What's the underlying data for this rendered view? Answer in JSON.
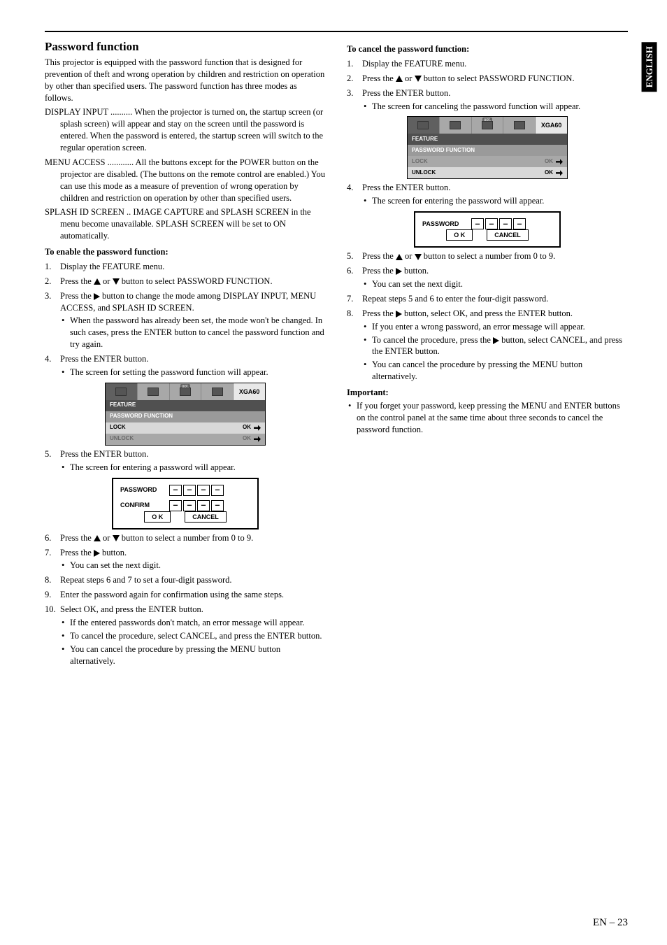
{
  "vert_label": "ENGLISH",
  "page_number": "EN – 23",
  "left": {
    "heading": "Password function",
    "intro": "This projector is equipped with the password function that is designed for prevention of theft and wrong operation by children and restriction on operation by other than specified users. The password function has three modes as follows.",
    "modes": [
      {
        "term": "DISPLAY INPUT",
        "dots": " .......... ",
        "def": "When the projector is turned on, the startup screen (or splash screen) will appear and stay on the screen until the password is entered. When the password is entered, the startup screen will switch to the regular operation screen."
      },
      {
        "term": "MENU ACCESS",
        "dots": " ............ ",
        "def": "All the buttons except for the POWER button on the projector are disabled. (The buttons on the remote control are enabled.) You can use this mode as a measure of prevention of wrong operation by children and restriction on operation by other than specified users."
      },
      {
        "term": "SPLASH ID SCREEN",
        "dots": " .. ",
        "def": "IMAGE CAPTURE and SPLASH SCREEN in the menu become unavailable. SPLASH SCREEN will be set to ON automatically."
      }
    ],
    "enable_head": "To enable the password function:",
    "enable_steps": [
      {
        "n": "1.",
        "t": "Display the FEATURE menu."
      },
      {
        "n": "2.",
        "t_before": "Press the ",
        "arrows": "ud",
        "t_after": " button to select PASSWORD FUNCTION."
      },
      {
        "n": "3.",
        "t_before": "Press the ",
        "arrows": "r",
        "t_after": " button to change the mode among DISPLAY INPUT, MENU ACCESS, and SPLASH ID SCREEN.",
        "bullets": [
          "When the password has already been set, the mode won't be changed. In such cases, press the ENTER button to cancel the password function and try again."
        ]
      },
      {
        "n": "4.",
        "t": "Press the ENTER button.",
        "bullets": [
          "The screen for setting the password function will appear."
        ]
      }
    ],
    "osd1": {
      "signal": "XGA60",
      "rows": [
        {
          "cls": "dark",
          "l": "FEATURE",
          "r": ""
        },
        {
          "cls": "grey",
          "l": "PASSWORD FUNCTION",
          "r": ""
        },
        {
          "cls": "light",
          "l": "LOCK",
          "r": "OK",
          "enter": true
        },
        {
          "cls": "dim",
          "l": "UNLOCK",
          "r": "OK",
          "enter": true
        }
      ]
    },
    "step5": {
      "n": "5.",
      "t": "Press the ENTER button.",
      "bullets": [
        "The screen for entering a password will appear."
      ]
    },
    "pw1": {
      "rows": [
        {
          "label": "PASSWORD",
          "digits": [
            "–",
            "–",
            "–",
            "–"
          ]
        },
        {
          "label": "CONFIRM",
          "digits": [
            "–",
            "–",
            "–",
            "–"
          ]
        }
      ],
      "buttons": [
        "O K",
        "CANCEL"
      ]
    },
    "steps_after_pw": [
      {
        "n": "6.",
        "t_before": "Press the ",
        "arrows": "ud",
        "t_after": " button to select a number from 0 to 9."
      },
      {
        "n": "7.",
        "t_before": "Press the ",
        "arrows": "r",
        "t_after": " button.",
        "bullets": [
          "You can set the next digit."
        ]
      },
      {
        "n": "8.",
        "t": "Repeat steps 6 and 7 to set a four-digit password."
      },
      {
        "n": "9.",
        "t": "Enter the password again for confirmation using the same steps."
      },
      {
        "n": "10.",
        "t": "Select OK, and press the ENTER button.",
        "bullets": [
          "If the entered passwords don't match, an error message will appear.",
          "To cancel the procedure, select CANCEL, and press the ENTER button.",
          "You can cancel the procedure by pressing the MENU button alternatively."
        ]
      }
    ]
  },
  "right": {
    "cancel_head": "To cancel the password function:",
    "cancel_steps_a": [
      {
        "n": "1.",
        "t": "Display the FEATURE menu."
      },
      {
        "n": "2.",
        "t_before": "Press the ",
        "arrows": "ud",
        "t_after": " button to select PASSWORD FUNCTION."
      },
      {
        "n": "3.",
        "t": "Press the ENTER button.",
        "bullets": [
          "The screen for canceling the password function will appear."
        ]
      }
    ],
    "osd2": {
      "signal": "XGA60",
      "rows": [
        {
          "cls": "dark",
          "l": "FEATURE",
          "r": ""
        },
        {
          "cls": "grey",
          "l": "PASSWORD FUNCTION",
          "r": ""
        },
        {
          "cls": "dim",
          "l": "LOCK",
          "r": "OK",
          "enter": true
        },
        {
          "cls": "light",
          "l": "UNLOCK",
          "r": "OK",
          "enter": true
        }
      ]
    },
    "step4": {
      "n": "4.",
      "t": "Press the ENTER button.",
      "bullets": [
        "The screen for entering the password will appear."
      ]
    },
    "pw2": {
      "rows": [
        {
          "label": "PASSWORD",
          "digits": [
            "–",
            "–",
            "–",
            "–"
          ]
        }
      ],
      "buttons": [
        "O K",
        "CANCEL"
      ]
    },
    "cancel_steps_b": [
      {
        "n": "5.",
        "t_before": "Press the ",
        "arrows": "ud",
        "t_after": " button to select a number from 0 to 9."
      },
      {
        "n": "6.",
        "t_before": "Press the ",
        "arrows": "r",
        "t_after": " button.",
        "bullets": [
          "You can set the next digit."
        ]
      },
      {
        "n": "7.",
        "t": "Repeat steps 5 and 6 to enter the four-digit password."
      },
      {
        "n": "8.",
        "t_before": "Press the ",
        "arrows": "r",
        "t_after": " button, select OK, and press the ENTER button.",
        "bullets": [
          "If you enter a wrong password, an error message will appear.",
          {
            "before": "To cancel the procedure, press the ",
            "arrows": "r",
            "after": " button, select CANCEL, and press the ENTER button."
          },
          "You can cancel the procedure by pressing the MENU button alternatively."
        ]
      }
    ],
    "important_head": "Important:",
    "important_bullet": "If you forget your password, keep pressing the MENU and ENTER buttons on the control panel at the same time about three seconds to cancel the password function."
  }
}
